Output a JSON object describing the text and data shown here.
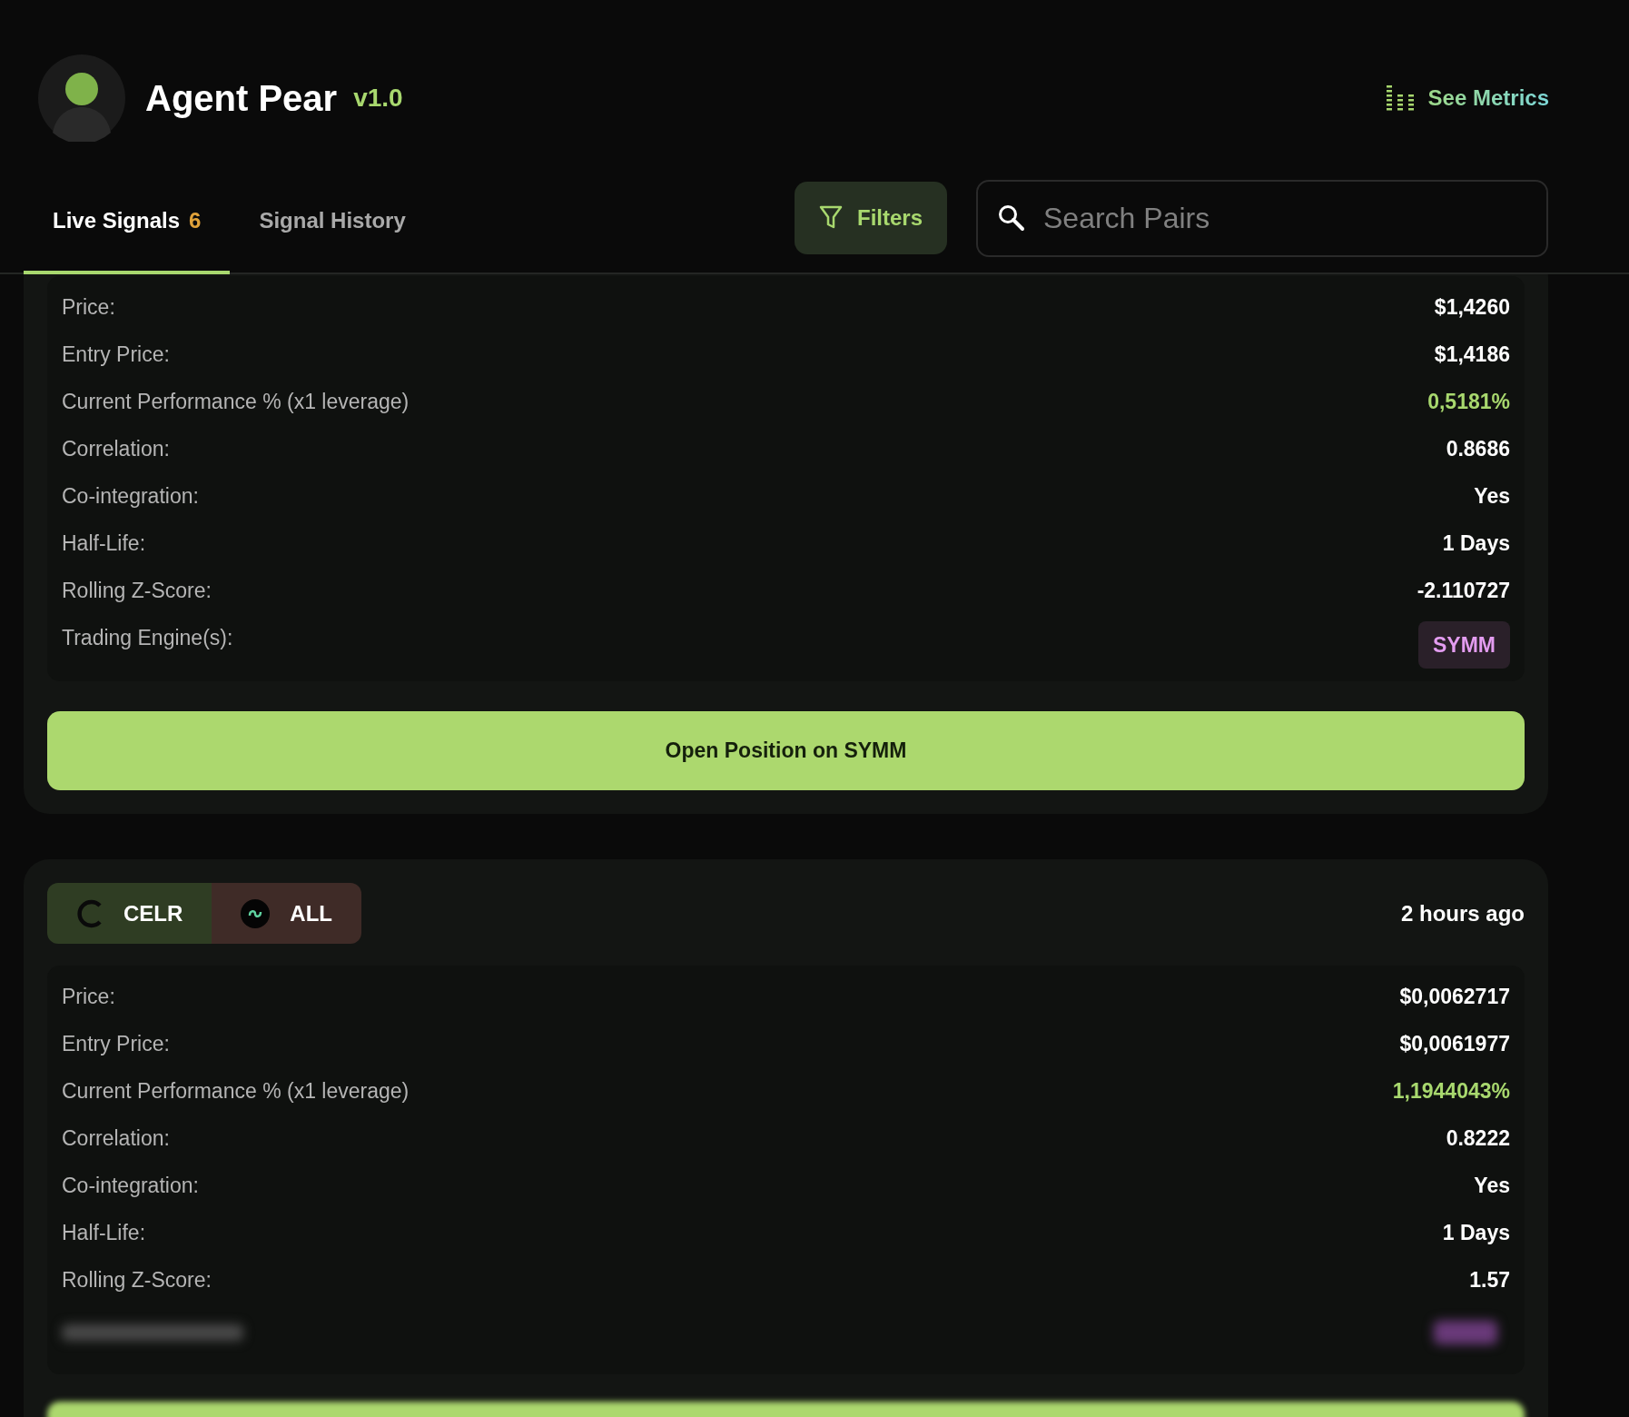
{
  "app": {
    "name": "Agent Pear",
    "version": "v1.0",
    "metrics_link": "See Metrics"
  },
  "tabs": [
    {
      "label": "Live Signals",
      "count": "6",
      "selected": true
    },
    {
      "label": "Signal History",
      "selected": false
    }
  ],
  "filters_button": "Filters",
  "search": {
    "placeholder": "Search Pairs"
  },
  "signals": [
    {
      "rows": [
        {
          "label": "Price:",
          "value": "$1,4260",
          "kind": "plain"
        },
        {
          "label": "Entry Price:",
          "value": "$1,4186",
          "kind": "plain"
        },
        {
          "label": "Current Performance % (x1 leverage)",
          "value": "0,5181%",
          "kind": "positive"
        },
        {
          "label": "Correlation:",
          "value": "0.8686",
          "kind": "plain"
        },
        {
          "label": "Co-integration:",
          "value": "Yes",
          "kind": "plain"
        },
        {
          "label": "Half-Life:",
          "value": "1 Days",
          "kind": "plain"
        },
        {
          "label": "Rolling Z-Score:",
          "value": "-2.110727",
          "kind": "plain"
        }
      ],
      "engine_label": "Trading Engine(s):",
      "engines": [
        "SYMM"
      ],
      "action": "Open Position on SYMM",
      "footer_obscured": false
    },
    {
      "pair": [
        {
          "symbol": "CELR",
          "color": "#2f3d23"
        },
        {
          "symbol": "ALL",
          "color": "#3f2b27"
        }
      ],
      "time": "2 hours ago",
      "rows": [
        {
          "label": "Price:",
          "value": "$0,0062717",
          "kind": "plain"
        },
        {
          "label": "Entry Price:",
          "value": "$0,0061977",
          "kind": "plain"
        },
        {
          "label": "Current Performance % (x1 leverage)",
          "value": "1,1944043%",
          "kind": "positive"
        },
        {
          "label": "Correlation:",
          "value": "0.8222",
          "kind": "plain"
        },
        {
          "label": "Co-integration:",
          "value": "Yes",
          "kind": "plain"
        },
        {
          "label": "Half-Life:",
          "value": "1 Days",
          "kind": "plain"
        },
        {
          "label": "Rolling Z-Score:",
          "value": "1.57",
          "kind": "plain"
        }
      ],
      "footer_obscured": true
    }
  ]
}
